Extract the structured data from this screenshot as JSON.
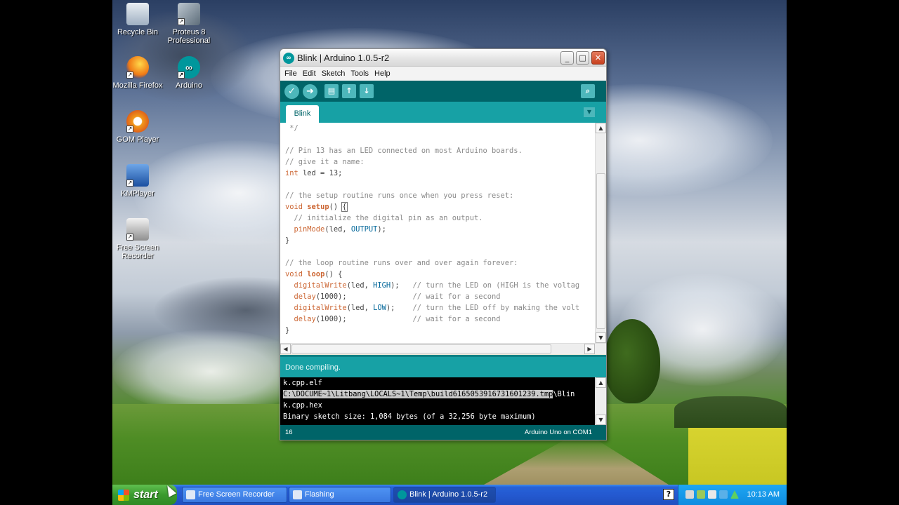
{
  "desktop": {
    "icons": [
      {
        "label": "Recycle Bin",
        "icon": "recycle-bin-icon"
      },
      {
        "label": "Proteus 8 Professional",
        "icon": "proteus-icon"
      },
      {
        "label": "Mozilla Firefox",
        "icon": "firefox-icon"
      },
      {
        "label": "Arduino",
        "icon": "arduino-icon"
      },
      {
        "label": "GOM Player",
        "icon": "gom-player-icon"
      },
      {
        "label": "KMPlayer",
        "icon": "kmplayer-icon"
      },
      {
        "label": "Free Screen Recorder",
        "icon": "screen-recorder-icon"
      }
    ]
  },
  "window": {
    "title": "Blink | Arduino 1.0.5-r2",
    "controls": {
      "minimize": "_",
      "maximize": "□",
      "close": "✕"
    },
    "menu": [
      "File",
      "Edit",
      "Sketch",
      "Tools",
      "Help"
    ],
    "toolbar": {
      "verify": "✓",
      "upload": "➜",
      "new": "▤",
      "open": "↑",
      "save": "↓",
      "serial_monitor": "⌕"
    },
    "tab": {
      "label": "Blink",
      "menu_arrow": "▼"
    },
    "status": "Done compiling.",
    "console_lines": [
      "k.cpp.elf",
      "C:\\DOCUME~1\\Litbang\\LOCALS~1\\Temp\\build6165053916731601239.tmp",
      "\\Blin",
      "k.cpp.hex",
      "Binary sketch size: 1,084 bytes (of a 32,256 byte maximum)"
    ],
    "footer": {
      "line_number": "16",
      "board": "Arduino Uno on COM1"
    }
  },
  "code_lines": [
    {
      "parts": [
        {
          "t": " */",
          "c": "cmt"
        }
      ]
    },
    {
      "parts": [
        {
          "t": "",
          "c": ""
        }
      ]
    },
    {
      "parts": [
        {
          "t": "// Pin 13 has an LED connected on most Arduino boards.",
          "c": "cmt"
        }
      ]
    },
    {
      "parts": [
        {
          "t": "// give it a name:",
          "c": "cmt"
        }
      ]
    },
    {
      "parts": [
        {
          "t": "int",
          "c": "kw"
        },
        {
          "t": " led = 13;",
          "c": ""
        }
      ]
    },
    {
      "parts": [
        {
          "t": "",
          "c": ""
        }
      ]
    },
    {
      "parts": [
        {
          "t": "// the setup routine runs once when you press reset:",
          "c": "cmt"
        }
      ]
    },
    {
      "parts": [
        {
          "t": "void",
          "c": "kw"
        },
        {
          "t": " ",
          "c": ""
        },
        {
          "t": "setup",
          "c": "fn"
        },
        {
          "t": "() ",
          "c": ""
        },
        {
          "t": "{",
          "c": "caret"
        }
      ]
    },
    {
      "parts": [
        {
          "t": "  // initialize the digital pin as an output.",
          "c": "cmt"
        }
      ]
    },
    {
      "parts": [
        {
          "t": "  ",
          "c": ""
        },
        {
          "t": "pinMode",
          "c": "kw"
        },
        {
          "t": "(led, ",
          "c": ""
        },
        {
          "t": "OUTPUT",
          "c": "cst"
        },
        {
          "t": ");",
          "c": ""
        }
      ]
    },
    {
      "parts": [
        {
          "t": "}",
          "c": ""
        }
      ]
    },
    {
      "parts": [
        {
          "t": "",
          "c": ""
        }
      ]
    },
    {
      "parts": [
        {
          "t": "// the loop routine runs over and over again forever:",
          "c": "cmt"
        }
      ]
    },
    {
      "parts": [
        {
          "t": "void",
          "c": "kw"
        },
        {
          "t": " ",
          "c": ""
        },
        {
          "t": "loop",
          "c": "fn"
        },
        {
          "t": "() {",
          "c": ""
        }
      ]
    },
    {
      "parts": [
        {
          "t": "  ",
          "c": ""
        },
        {
          "t": "digitalWrite",
          "c": "kw"
        },
        {
          "t": "(led, ",
          "c": ""
        },
        {
          "t": "HIGH",
          "c": "cst"
        },
        {
          "t": ");   ",
          "c": ""
        },
        {
          "t": "// turn the LED on (HIGH is the voltag",
          "c": "cmt"
        }
      ]
    },
    {
      "parts": [
        {
          "t": "  ",
          "c": ""
        },
        {
          "t": "delay",
          "c": "kw"
        },
        {
          "t": "(1000);               ",
          "c": ""
        },
        {
          "t": "// wait for a second",
          "c": "cmt"
        }
      ]
    },
    {
      "parts": [
        {
          "t": "  ",
          "c": ""
        },
        {
          "t": "digitalWrite",
          "c": "kw"
        },
        {
          "t": "(led, ",
          "c": ""
        },
        {
          "t": "LOW",
          "c": "cst"
        },
        {
          "t": ");    ",
          "c": ""
        },
        {
          "t": "// turn the LED off by making the volt",
          "c": "cmt"
        }
      ]
    },
    {
      "parts": [
        {
          "t": "  ",
          "c": ""
        },
        {
          "t": "delay",
          "c": "kw"
        },
        {
          "t": "(1000);               ",
          "c": ""
        },
        {
          "t": "// wait for a second",
          "c": "cmt"
        }
      ]
    },
    {
      "parts": [
        {
          "t": "}",
          "c": ""
        }
      ]
    }
  ],
  "scroll_glyphs": {
    "up": "▲",
    "down": "▼",
    "left": "◀",
    "right": "▶",
    "grip_v": "≡",
    "grip_h": "|||"
  },
  "taskbar": {
    "start_label": "start",
    "tasks": [
      "Free Screen Recorder",
      "Flashing",
      "Blink | Arduino 1.0.5-r2"
    ],
    "help_glyph": "?",
    "clock": "10:13 AM"
  },
  "colors": {
    "teal_dark": "#006468",
    "teal": "#17a1a5",
    "xp_blue": "#2459d0",
    "start_green": "#3a9a2e"
  }
}
